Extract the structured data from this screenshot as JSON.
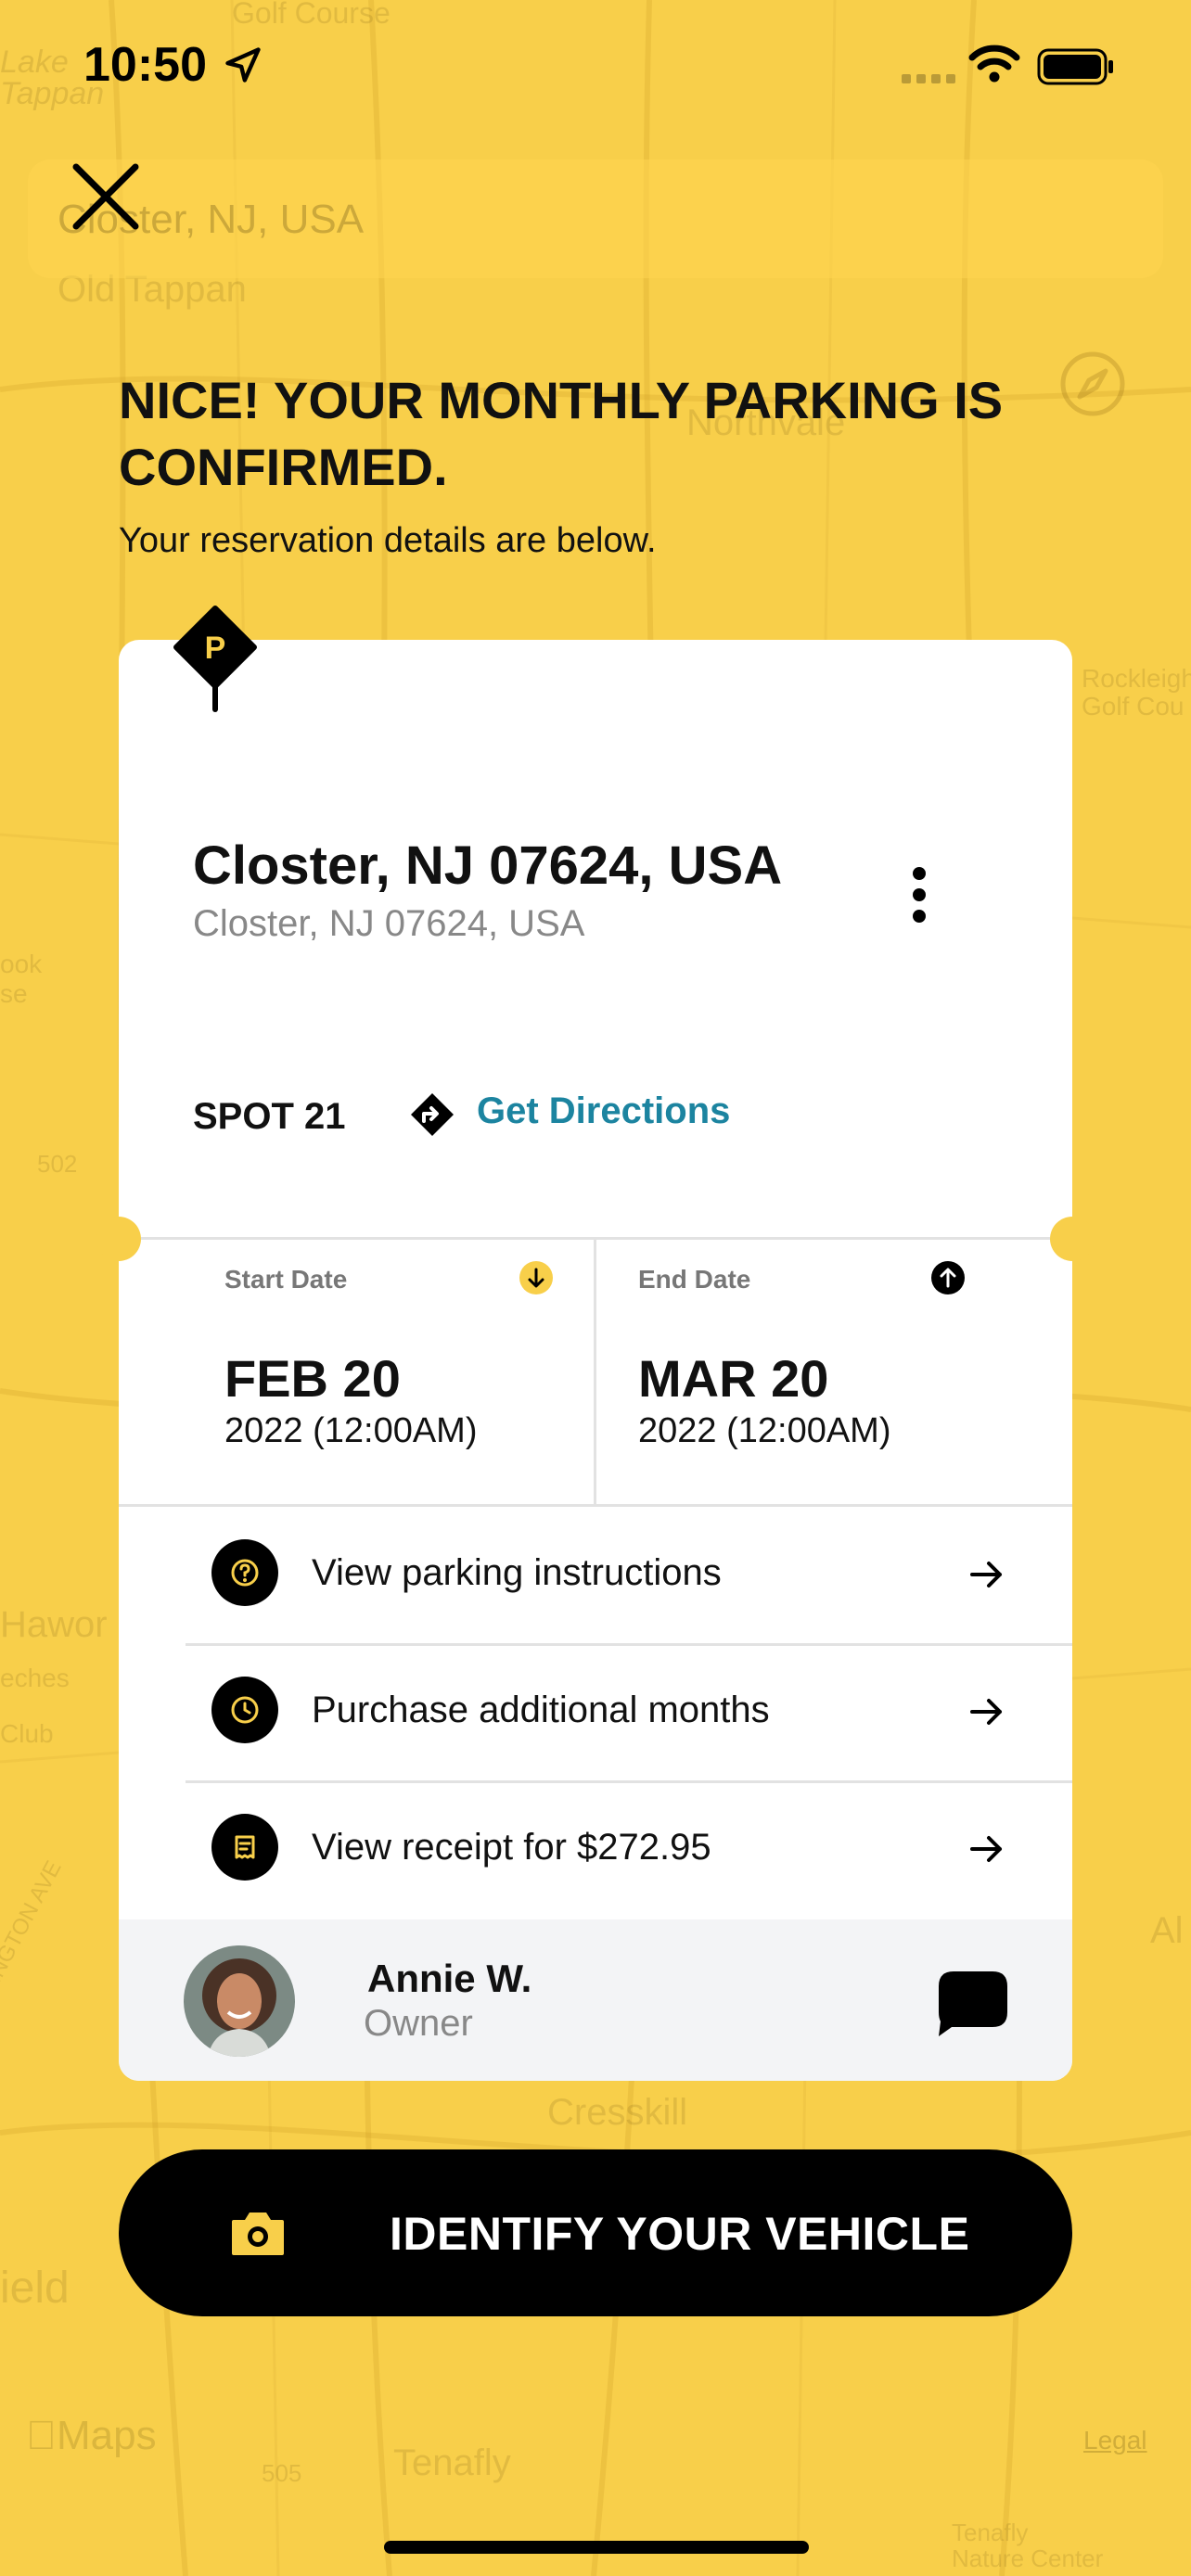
{
  "status_bar": {
    "time": "10:50"
  },
  "search": {
    "value": "Closter, NJ, USA"
  },
  "map": {
    "labels": [
      "Golf Course",
      "Lake",
      "Tappan",
      "Old Tappan",
      "Northvale",
      "Rockleigh",
      "Golf Cou",
      "ook",
      "se",
      "502",
      "Hawor",
      "eches",
      "Club",
      "INGTON AVE",
      "Cresskill",
      "ield",
      "Tenafly",
      "505",
      "Al",
      "Tenafly",
      "Nature Center"
    ],
    "maps_logo": "Maps",
    "legal": "Legal"
  },
  "confirmation": {
    "headline": "NICE! YOUR MONTHLY PARKING IS CONFIRMED.",
    "subline": "Your reservation details are below."
  },
  "card": {
    "pin_letter": "P",
    "title": "Closter, NJ 07624, USA",
    "subtitle": "Closter, NJ 07624, USA",
    "spot": "SPOT 21",
    "directions": "Get Directions",
    "start": {
      "label": "Start Date",
      "month_day": "FEB 20",
      "year_time": "2022 (12:00AM)"
    },
    "end": {
      "label": "End Date",
      "month_day": "MAR 20",
      "year_time": "2022 (12:00AM)"
    },
    "rows": [
      {
        "label": "View parking instructions",
        "icon": "question-icon"
      },
      {
        "label": "Purchase additional months",
        "icon": "clock-icon"
      },
      {
        "label": "View receipt for $272.95",
        "icon": "receipt-icon"
      }
    ],
    "owner": {
      "name": "Annie W.",
      "role": "Owner"
    }
  },
  "cta": {
    "label": "IDENTIFY YOUR VEHICLE"
  },
  "colors": {
    "background": "#f8cf4a",
    "accent_link": "#1c84a0",
    "card": "#ffffff",
    "button": "#000000"
  }
}
